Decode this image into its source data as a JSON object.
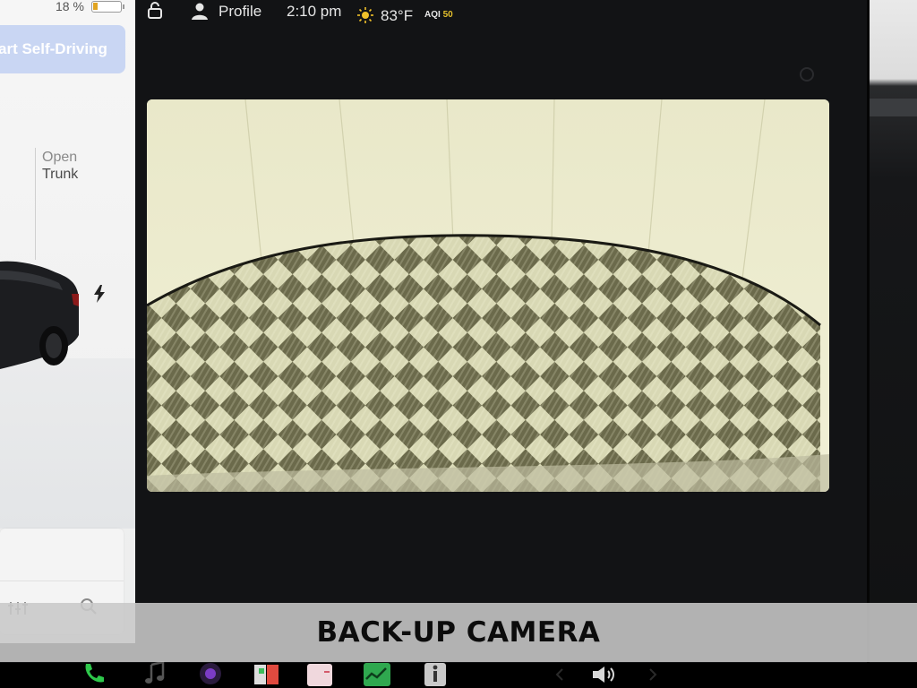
{
  "status_bar": {
    "battery_percent": "18 %",
    "battery_level": 0.18,
    "profile_label": "Profile",
    "time": "2:10 pm",
    "temperature": "83°F",
    "aqi_label": "AQI",
    "aqi_value": "50"
  },
  "left_panel": {
    "self_driving_button": "art Self-Driving",
    "trunk_state": "Open",
    "trunk_label": "Trunk"
  },
  "camera": {
    "caption": "BACK-UP CAMERA"
  },
  "dock": {
    "items": [
      "phone-icon",
      "music-icon",
      "camera-app-icon",
      "calendar-icon",
      "notes-icon",
      "energy-icon",
      "manual-icon",
      "volume-icon"
    ]
  },
  "colors": {
    "fsd_button": "#c9d6f3",
    "phone": "#2ec84b",
    "energy": "#2fa84f",
    "aqi": "#e3bf2c",
    "battery_fill": "#e1a422"
  }
}
